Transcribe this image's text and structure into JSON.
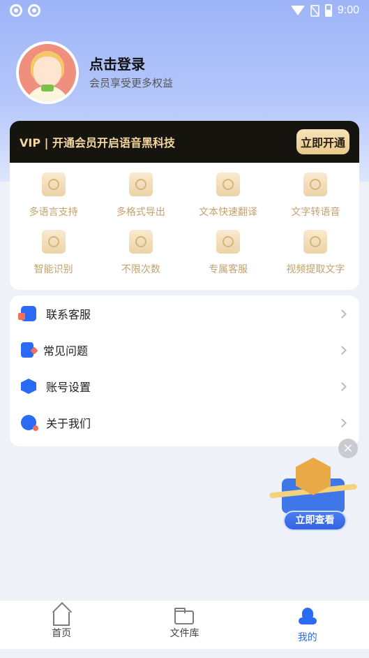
{
  "status_bar": {
    "time": "9:00"
  },
  "profile": {
    "title": "点击登录",
    "subtitle": "会员享受更多权益"
  },
  "vip_banner": {
    "text": "VIP | 开通会员开启语音黑科技",
    "button": "立即开通"
  },
  "features": [
    {
      "label": "多语言支持",
      "icon": "en-doc-icon"
    },
    {
      "label": "多格式导出",
      "icon": "folder-export-icon"
    },
    {
      "label": "文本快速翻译",
      "icon": "translate-icon"
    },
    {
      "label": "文字转语音",
      "icon": "microphone-icon"
    },
    {
      "label": "智能识别",
      "icon": "scan-target-icon"
    },
    {
      "label": "不限次数",
      "icon": "infinity-icon"
    },
    {
      "label": "专属客服",
      "icon": "headset-icon"
    },
    {
      "label": "视频提取文字",
      "icon": "video-icon"
    }
  ],
  "menu": [
    {
      "label": "联系客服",
      "icon": "customer-service-icon"
    },
    {
      "label": "常见问题",
      "icon": "faq-icon"
    },
    {
      "label": "账号设置",
      "icon": "account-settings-icon"
    },
    {
      "label": "关于我们",
      "icon": "info-icon"
    }
  ],
  "promo": {
    "button": "立即查看",
    "close": "×"
  },
  "bottom_nav": [
    {
      "label": "首页",
      "icon": "home-icon"
    },
    {
      "label": "文件库",
      "icon": "folder-icon"
    },
    {
      "label": "我的",
      "icon": "person-icon",
      "active": true
    }
  ],
  "colors": {
    "accent": "#2b6af3",
    "gold": "#c2a270",
    "vip_bg": "#15140f"
  }
}
